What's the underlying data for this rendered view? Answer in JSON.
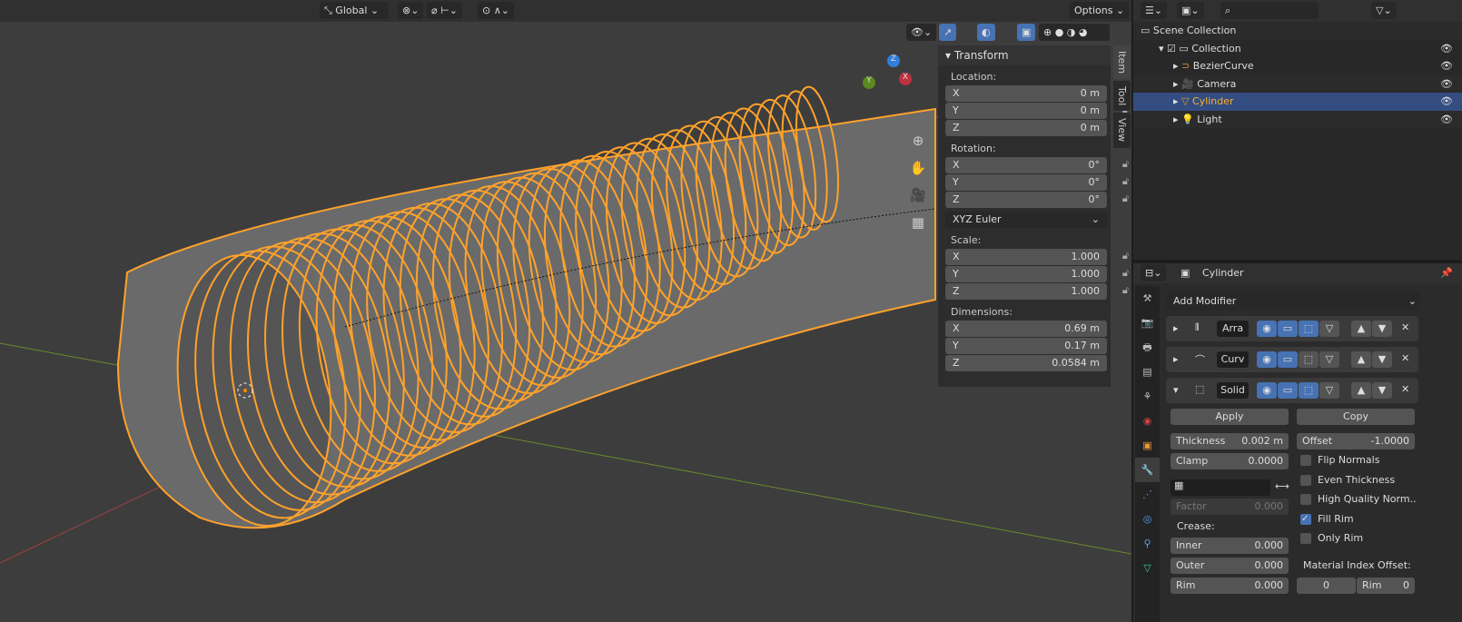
{
  "header": {
    "orientation": "Global",
    "options": "Options"
  },
  "npanel": {
    "title": "Transform",
    "tabs": [
      "Item",
      "Tool",
      "View"
    ],
    "location_label": "Location:",
    "location": [
      [
        "X",
        "0 m"
      ],
      [
        "Y",
        "0 m"
      ],
      [
        "Z",
        "0 m"
      ]
    ],
    "rotation_label": "Rotation:",
    "rotation": [
      [
        "X",
        "0°"
      ],
      [
        "Y",
        "0°"
      ],
      [
        "Z",
        "0°"
      ]
    ],
    "rotation_mode": "XYZ Euler",
    "scale_label": "Scale:",
    "scale": [
      [
        "X",
        "1.000"
      ],
      [
        "Y",
        "1.000"
      ],
      [
        "Z",
        "1.000"
      ]
    ],
    "dimensions_label": "Dimensions:",
    "dimensions": [
      [
        "X",
        "0.69 m"
      ],
      [
        "Y",
        "0.17 m"
      ],
      [
        "Z",
        "0.0584 m"
      ]
    ]
  },
  "gizmo": {
    "x": "X",
    "y": "Y",
    "z": "Z"
  },
  "outliner": {
    "root": "Scene Collection",
    "collection": "Collection",
    "items": [
      {
        "label": "BezierCurve",
        "selected": false
      },
      {
        "label": "Camera",
        "selected": false
      },
      {
        "label": "Cylinder",
        "selected": true
      },
      {
        "label": "Light",
        "selected": false
      }
    ]
  },
  "properties": {
    "object": "Cylinder",
    "add_modifier": "Add Modifier",
    "modifiers": [
      {
        "name": "Arra",
        "expanded": false
      },
      {
        "name": "Curv",
        "expanded": false
      },
      {
        "name": "Solid",
        "expanded": true
      }
    ],
    "apply": "Apply",
    "copy": "Copy",
    "thickness_label": "Thickness",
    "thickness": "0.002 m",
    "offset_label": "Offset",
    "offset": "-1.0000",
    "clamp_label": "Clamp",
    "clamp": "0.0000",
    "factor_label": "Factor",
    "factor": "0.000",
    "crease_label": "Crease:",
    "inner_label": "Inner",
    "inner": "0.000",
    "outer_label": "Outer",
    "outer": "0.000",
    "rim_label": "Rim",
    "rim": "0.000",
    "checks": [
      {
        "label": "Flip Normals",
        "checked": false
      },
      {
        "label": "Even Thickness",
        "checked": false
      },
      {
        "label": "High Quality Norm..",
        "checked": false
      },
      {
        "label": "Fill Rim",
        "checked": true
      },
      {
        "label": "Only Rim",
        "checked": false
      }
    ],
    "material_offset_label": "Material Index Offset:",
    "material_offset": "0",
    "material_rim_label": "Rim",
    "material_rim": "0"
  },
  "colors": {
    "accent": "#4772b3",
    "selection": "#ffa22b"
  }
}
